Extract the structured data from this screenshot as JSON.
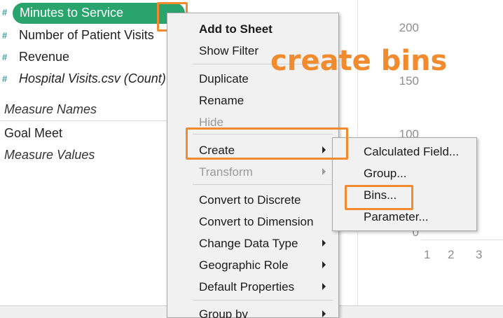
{
  "data_pane": {
    "selected_field": "Minutes to Service",
    "measures": [
      {
        "label": "Number of Patient Visits",
        "italic": false
      },
      {
        "label": "Revenue",
        "italic": false
      },
      {
        "label": "Hospital Visits.csv (Count)",
        "italic": true
      }
    ],
    "measure_icon": "#",
    "section_measure_names": "Measure Names",
    "goal_meet": "Goal Meet",
    "measure_values": "Measure Values"
  },
  "chart": {
    "y_ticks": [
      "200",
      "150",
      "100",
      "0"
    ],
    "x_ticks": [
      "1",
      "2",
      "3"
    ]
  },
  "context_menu": {
    "add_to_sheet": "Add to Sheet",
    "show_filter": "Show Filter",
    "duplicate": "Duplicate",
    "rename": "Rename",
    "hide": "Hide",
    "create": "Create",
    "transform": "Transform",
    "convert_discrete": "Convert to Discrete",
    "convert_dimension": "Convert to Dimension",
    "change_data_type": "Change Data Type",
    "geographic_role": "Geographic Role",
    "default_properties": "Default Properties",
    "group_by": "Group by"
  },
  "create_submenu": {
    "calculated_field": "Calculated Field...",
    "group": "Group...",
    "bins": "Bins...",
    "parameter": "Parameter..."
  },
  "annotation": "create bins",
  "colors": {
    "highlight": "#f28a2e",
    "selected_pill": "#28a46c",
    "measure_icon": "#3fa1a0"
  }
}
